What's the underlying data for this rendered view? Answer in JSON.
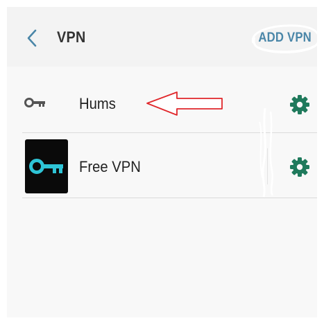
{
  "header": {
    "title": "VPN",
    "add_label": "ADD VPN"
  },
  "vpn_list": [
    {
      "name": "Hums",
      "icon": "key-icon"
    },
    {
      "name": "Free VPN",
      "icon": "free-vpn-app-icon"
    }
  ],
  "colors": {
    "accent": "#4a86a8",
    "gear": "#1f7a5c",
    "app_key": "#2ec4d6",
    "annotation_arrow": "#e0262a"
  }
}
